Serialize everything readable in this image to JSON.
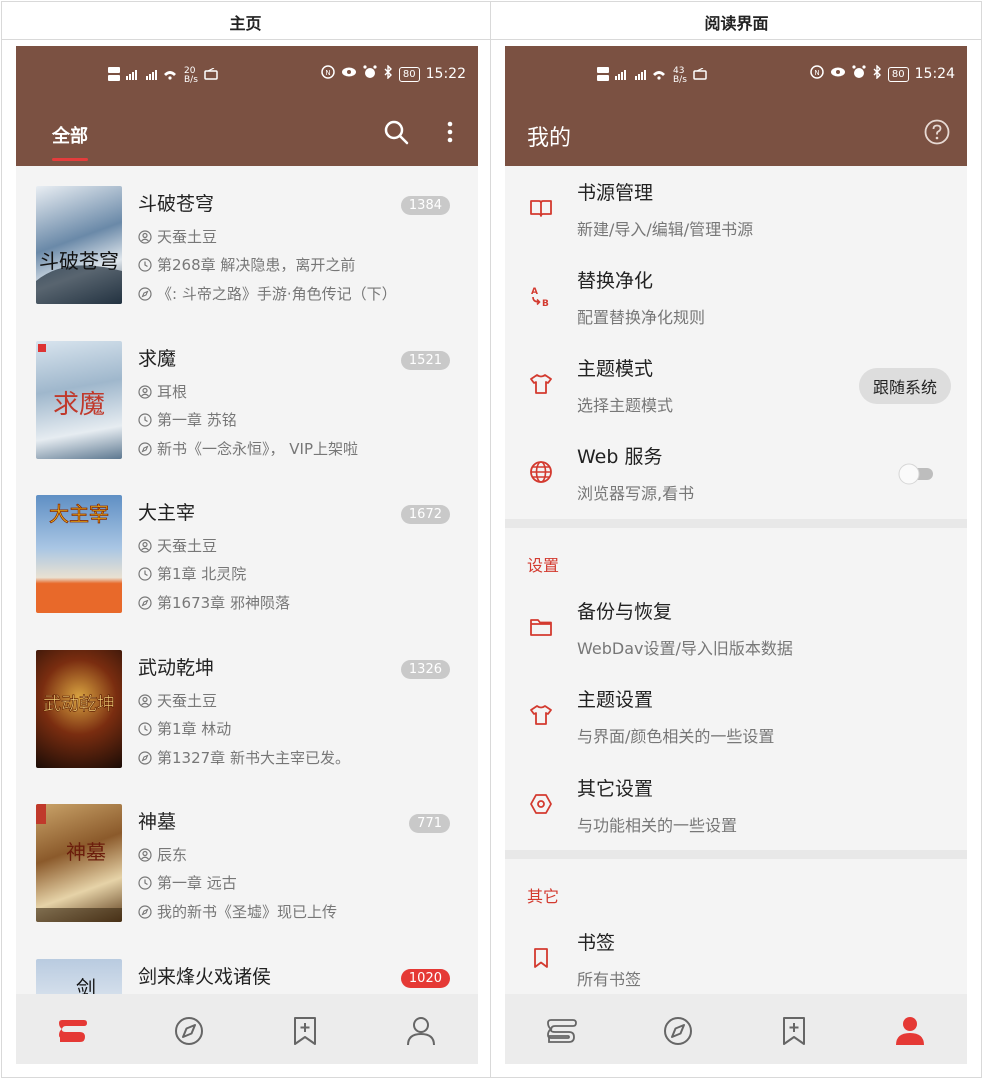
{
  "headers": {
    "left": "主页",
    "right": "阅读界面"
  },
  "colors": {
    "brand": "#7b5142",
    "accent": "#e53935",
    "bg": "#f4f4f4"
  },
  "left_phone": {
    "status": {
      "net_speed_top": "20",
      "net_speed_unit": "B/s",
      "battery": "80",
      "time": "15:22"
    },
    "appbar": {
      "tab_label": "全部",
      "icons": [
        "search-icon",
        "more-vertical-icon"
      ]
    },
    "books": [
      {
        "title": "斗破苍穹",
        "author": "天蚕土豆",
        "read_chapter": "第268章 解决隐患，离开之前",
        "latest_chapter": "《: 斗帝之路》手游·角色传记（下）",
        "count": "1384",
        "badge": "grey"
      },
      {
        "title": "求魔",
        "author": "耳根",
        "read_chapter": "第一章 苏铭",
        "latest_chapter": "新书《一念永恒》， VIP上架啦",
        "count": "1521",
        "badge": "grey"
      },
      {
        "title": "大主宰",
        "author": "天蚕土豆",
        "read_chapter": "第1章 北灵院",
        "latest_chapter": "第1673章 邪神陨落",
        "count": "1672",
        "badge": "grey"
      },
      {
        "title": "武动乾坤",
        "author": "天蚕土豆",
        "read_chapter": "第1章 林动",
        "latest_chapter": "第1327章 新书大主宰已发。",
        "count": "1326",
        "badge": "grey"
      },
      {
        "title": "神墓",
        "author": "辰东",
        "read_chapter": "第一章 远古",
        "latest_chapter": "我的新书《圣墟》现已上传",
        "count": "771",
        "badge": "grey"
      },
      {
        "title": "剑来烽火戏诸侯",
        "author": "",
        "read_chapter": "",
        "latest_chapter": "",
        "count": "1020",
        "badge": "red"
      }
    ],
    "cover_texts": [
      "斗破苍穹",
      "求魔",
      "大主宰",
      "武动乾坤",
      "神墓",
      "剑"
    ],
    "nav": [
      "bookshelf-icon",
      "compass-icon",
      "bookmark-add-icon",
      "person-icon"
    ]
  },
  "right_phone": {
    "status": {
      "net_speed_top": "43",
      "net_speed_unit": "B/s",
      "battery": "80",
      "time": "15:24"
    },
    "appbar": {
      "title": "我的",
      "help_icon": "help-circle-icon"
    },
    "items_top": [
      {
        "title": "书源管理",
        "sub": "新建/导入/编辑/管理书源",
        "icon": "book-open-icon"
      },
      {
        "title": "替换净化",
        "sub": "配置替换净化规则",
        "icon": "replace-ab-icon"
      },
      {
        "title": "主题模式",
        "sub": "选择主题模式",
        "icon": "tshirt-icon",
        "pill": "跟随系统"
      },
      {
        "title": "Web 服务",
        "sub": "浏览器写源,看书",
        "icon": "globe-icon",
        "toggle": "off"
      }
    ],
    "section_settings": "设置",
    "items_settings": [
      {
        "title": "备份与恢复",
        "sub": "WebDav设置/导入旧版本数据",
        "icon": "folder-icon"
      },
      {
        "title": "主题设置",
        "sub": "与界面/颜色相关的一些设置",
        "icon": "tshirt-icon"
      },
      {
        "title": "其它设置",
        "sub": "与功能相关的一些设置",
        "icon": "hexagon-settings-icon"
      }
    ],
    "section_other": "其它",
    "items_other": [
      {
        "title": "书签",
        "sub": "所有书签",
        "icon": "bookmark-icon"
      }
    ],
    "nav": [
      "bookshelf-icon",
      "compass-icon",
      "bookmark-add-icon",
      "person-icon"
    ]
  }
}
